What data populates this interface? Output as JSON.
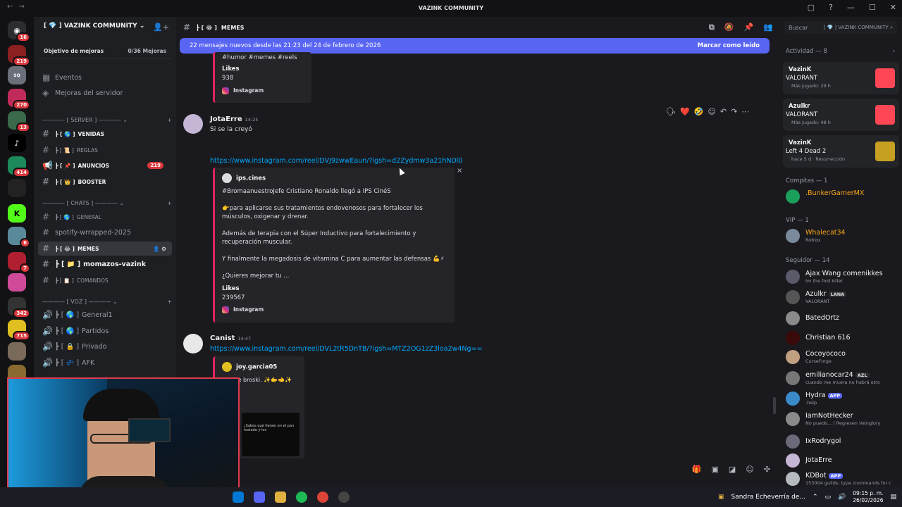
{
  "titlebar": {
    "title": "VAZINK COMMUNITY"
  },
  "server": {
    "name": "VAZINK COMMUNITY",
    "boost_label": "Objetivo de mejoras",
    "boost_progress": "0/36 Mejoras"
  },
  "nav": {
    "events": "Eventos",
    "improvements": "Mejoras del servidor"
  },
  "rail_badges": [
    "16",
    "219",
    "270",
    "13",
    "414",
    "6",
    "7",
    "342",
    "715"
  ],
  "categories": {
    "server": "[ SERVER ]",
    "chats": "[ CHATS ]",
    "voice": "[ VOZ ]"
  },
  "channels": [
    {
      "name": "VENIDAS"
    },
    {
      "name": "REGLAS"
    },
    {
      "name": "ANUNCIOS",
      "badge": "219"
    },
    {
      "name": "BOOSTER"
    },
    {
      "name": "GENERAL"
    },
    {
      "name": "spotify-wrrapped-2025"
    },
    {
      "name": "MEMES"
    },
    {
      "name": "momazos-vazink"
    },
    {
      "name": "COMANDOS"
    },
    {
      "name": "General1"
    },
    {
      "name": "Partidos"
    },
    {
      "name": "Privado"
    },
    {
      "name": "AFK"
    }
  ],
  "header": {
    "channel": "MEMES"
  },
  "new_messages": {
    "text": "22 mensajes nuevos desde las 21:23 del 24 de febrero de 2026",
    "action": "Marcar como leído"
  },
  "embed0": {
    "tags": "#humor #memes #reels",
    "likes_label": "Likes",
    "likes": "938",
    "source": "Instagram"
  },
  "msg1": {
    "author": "JotaErre",
    "time": "14:25",
    "text": "Si se la creyó",
    "link": "https://www.instagram.com/reel/DVJ9zwwEaun/?igsh=d2Zydmw3a21hNDl0",
    "embed_author": "ips.cines",
    "line1": "#BromaanuestroJefe Cristiano Ronaldo llegó a IPS CinéS",
    "line2": "👉para aplicarse sus tratamientos endovenosos para fortalecer los músculos, oxigenar y drenar.",
    "line3": "Además de terapia con el Súper Inductivo para fortalecimiento y recuperación muscular.",
    "line4": "Y finalmente la megadosis de vitamina C para aumentar las defensas 💪⚡",
    "line5": "¿Quieres mejorar tu ...",
    "likes_label": "Likes",
    "likes": "239567",
    "source": "Instagram"
  },
  "msg2": {
    "author": "Canist",
    "time": "14:47",
    "link": "https://www.instagram.com/reel/DVL2tR5DnTB/?igsh=MTZ2OG1zZ3loa2w4Ng==",
    "embed_author": "joy.garcia05",
    "text": "Ok ese broski. ✨🫱🫲✨",
    "thumb_text": "¿Sabes qué tienen en el pan tostado y los"
  },
  "search": {
    "placeholder": "Buscar",
    "scope": "VAZINK COMMUNITY"
  },
  "activity": {
    "title": "Actividad — 8",
    "cards": [
      {
        "name": "VazinK",
        "game": "VALORANT",
        "sub": "Más jugado: 29 h"
      },
      {
        "name": "Azulkr",
        "game": "VALORANT",
        "sub": "Más jugado: 48 h"
      },
      {
        "name": "VazinK",
        "game": "Left 4 Dead 2",
        "sub": "hace 5 d · Resurrección"
      }
    ]
  },
  "groups": [
    {
      "title": "Compitas — 1",
      "members": [
        {
          "name": ".BunkerGamerMX",
          "status": ""
        }
      ]
    },
    {
      "title": "VIP — 1",
      "members": [
        {
          "name": "Whalecat34",
          "status": "Roblox"
        }
      ]
    },
    {
      "title": "Seguidor — 14",
      "members": [
        {
          "name": "Ajax Wang comenikkes",
          "status": "Im the foid killer"
        },
        {
          "name": "Azulkr",
          "tag": "LANA",
          "status": "VALORANT"
        },
        {
          "name": "BatedOrtz",
          "status": ""
        },
        {
          "name": "Christian 616",
          "status": ""
        },
        {
          "name": "Cocoyococo",
          "status": "CurseForge"
        },
        {
          "name": "emilianocar24",
          "tag": "AZL",
          "status": "cuando me muera no habrá otro"
        },
        {
          "name": "Hydra",
          "tag": "APP",
          "status": ".help"
        },
        {
          "name": "IamNotHecker",
          "status": "No puedo... | Regresen Vainglory"
        },
        {
          "name": "IxRodrygol",
          "status": ""
        },
        {
          "name": "JotaErre",
          "status": ""
        },
        {
          "name": "KDBot",
          "tag": "APP",
          "status": "153004 guilds; type /commands for c"
        }
      ]
    }
  ],
  "taskbar": {
    "app": "Sandra Echeverría de...",
    "time": "09:15 p. m.",
    "date": "26/02/2026"
  },
  "colors": {
    "accent": "#5865f2",
    "badge": "#da373c",
    "link": "#00a8fc",
    "webcam_border": "#e23b4a"
  }
}
